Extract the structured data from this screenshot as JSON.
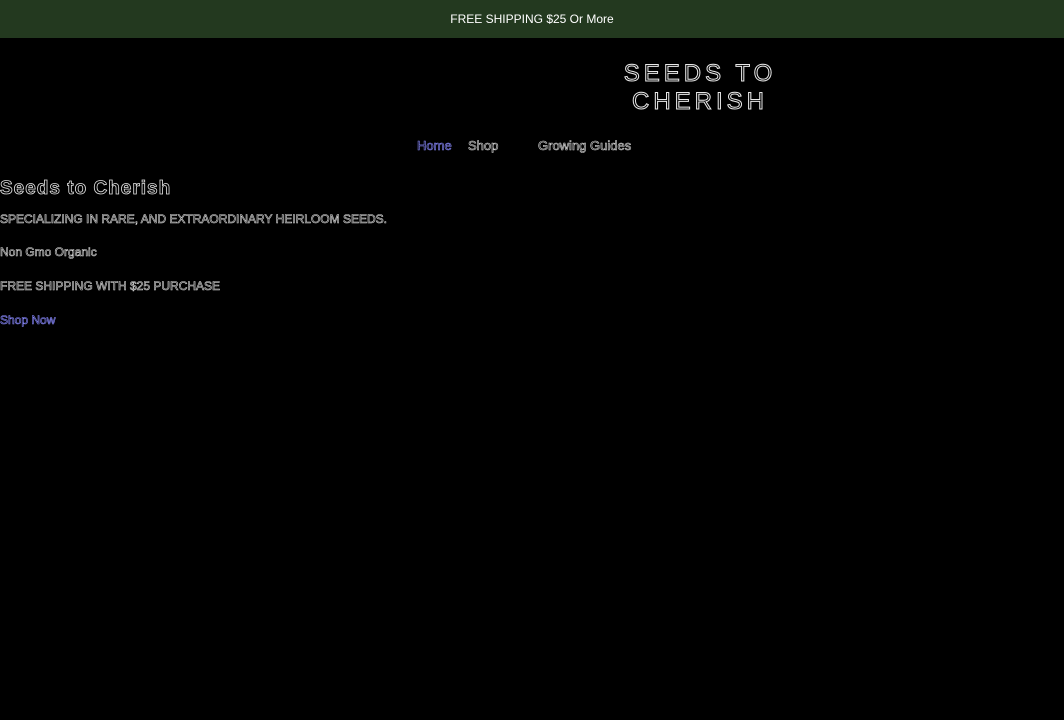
{
  "announcement": {
    "text": "FREE SHIPPING $25 Or More"
  },
  "logo": {
    "line1": "SEEDS TO",
    "line2": "CHERISH"
  },
  "nav": {
    "items": [
      {
        "label": "Home"
      },
      {
        "label": "Shop"
      },
      {
        "label": "Growing Guides"
      }
    ]
  },
  "hero": {
    "title": "Seeds to Cherish",
    "tagline": "SPECIALIZING IN RARE, AND EXTRAORDINARY HEIRLOOM SEEDS.",
    "subtitle": "Non Gmo Organic",
    "shipping": "FREE SHIPPING WITH $25 PURCHASE",
    "cta_label": "Shop Now"
  },
  "colors": {
    "announcement_bg": "#23391f",
    "page_bg": "#000000",
    "link_accent": "#8a8aff"
  }
}
